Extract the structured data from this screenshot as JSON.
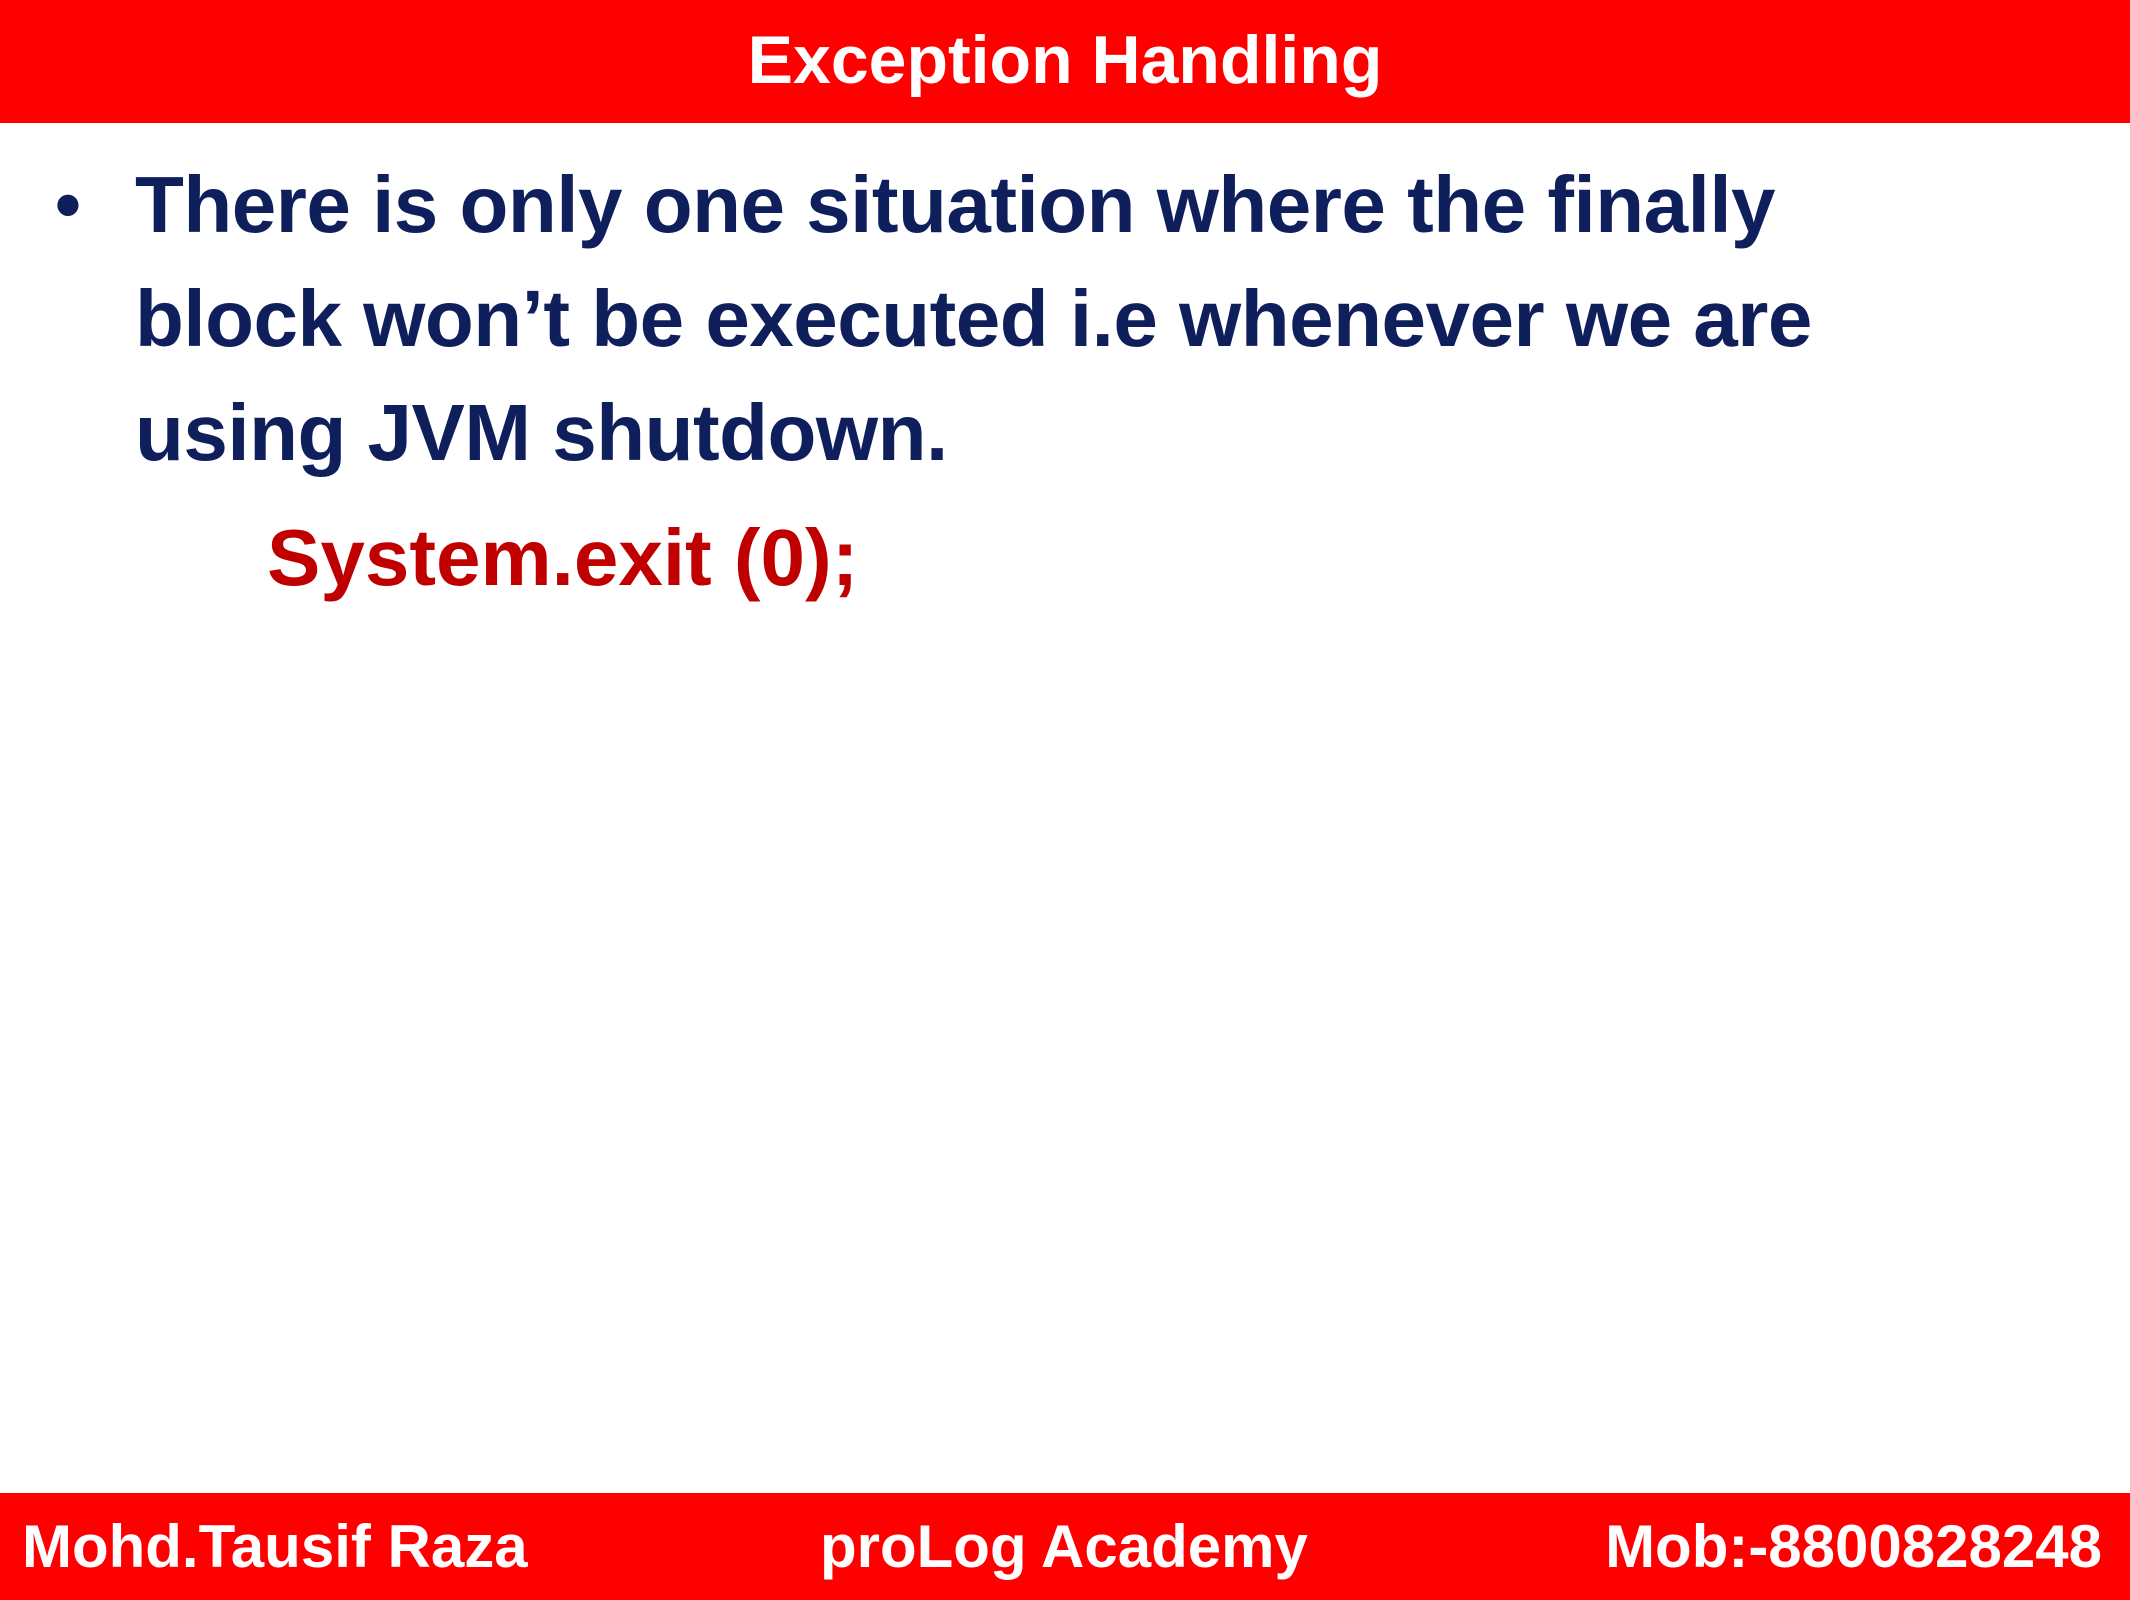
{
  "header": {
    "title": "Exception Handling"
  },
  "content": {
    "bullet_symbol": "•",
    "bullet_text": "There is only one situation where the finally block won’t be executed i.e whenever we are using  JVM shutdown.",
    "code_line": "System.exit (0);"
  },
  "footer": {
    "author": "Mohd.Tausif Raza",
    "organization": "proLog Academy",
    "mobile": "Mob:-8800828248"
  },
  "colors": {
    "header_bg": "#ff0000",
    "header_text": "#ffffff",
    "bullet_text": "#0f1f5c",
    "code_text": "#c00000",
    "footer_bg": "#ff0000",
    "footer_text": "#ffffff",
    "page_bg": "#ffffff"
  }
}
